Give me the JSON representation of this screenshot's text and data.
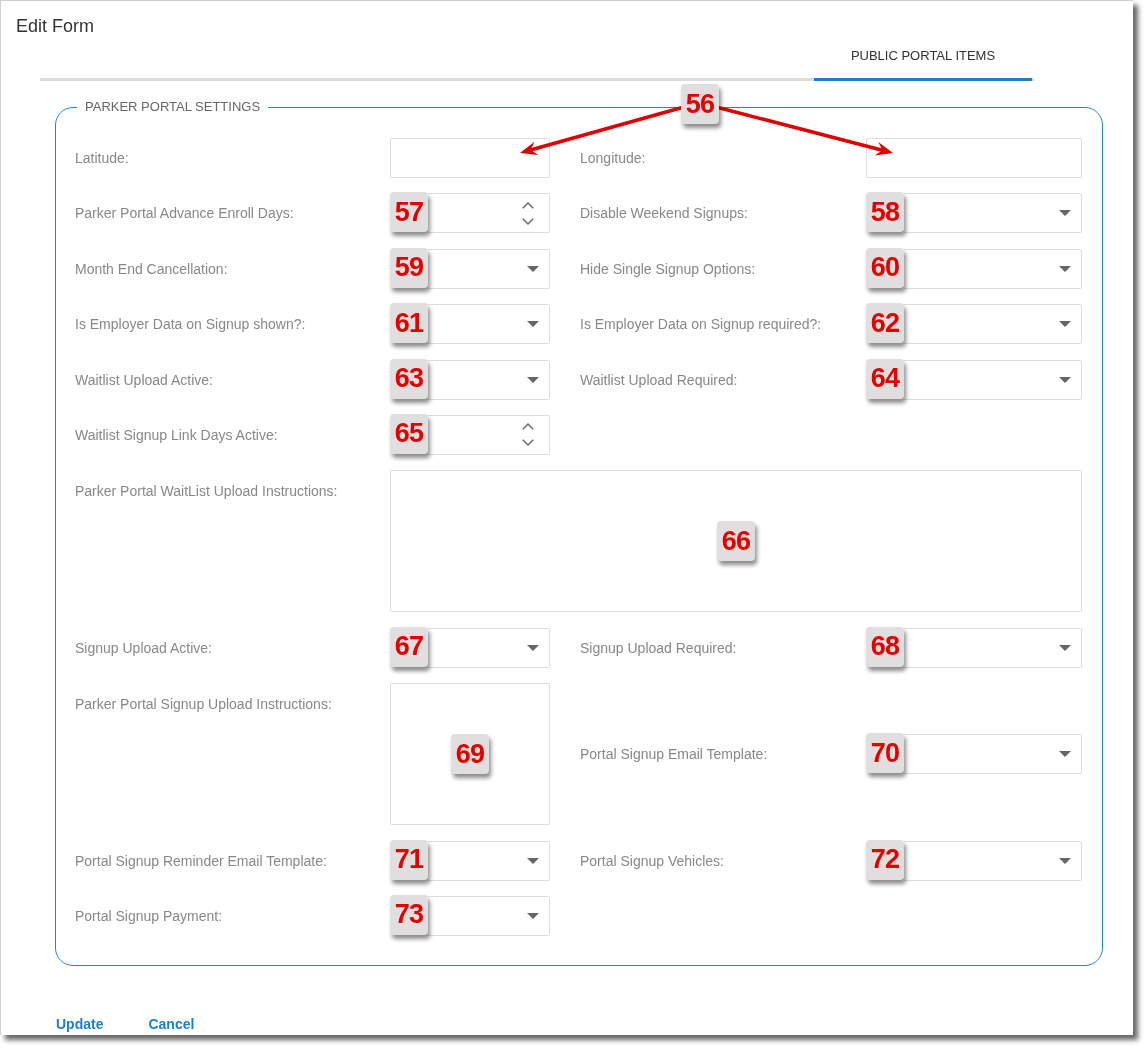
{
  "dialog": {
    "title": "Edit Form"
  },
  "tabs": [
    {
      "label": "PUBLIC PORTAL ITEMS",
      "selected": true
    }
  ],
  "fieldset": {
    "legend": "PARKER PORTAL SETTINGS",
    "rows": [
      {
        "callout": "56",
        "fields": [
          {
            "label": "Latitude:",
            "kind": "text"
          },
          {
            "label": "Longitude:",
            "kind": "text"
          }
        ]
      },
      {
        "fields": [
          {
            "label": "Parker Portal Advance Enroll Days:",
            "kind": "number",
            "callout": "57"
          },
          {
            "label": "Disable Weekend Signups:",
            "kind": "select",
            "callout": "58"
          }
        ]
      },
      {
        "fields": [
          {
            "label": "Month End Cancellation:",
            "kind": "select",
            "callout": "59"
          },
          {
            "label": "Hide Single Signup Options:",
            "kind": "select",
            "callout": "60"
          }
        ]
      },
      {
        "fields": [
          {
            "label": "Is Employer Data on Signup shown?:",
            "kind": "select",
            "callout": "61"
          },
          {
            "label": "Is Employer Data on Signup required?:",
            "kind": "select",
            "callout": "62"
          }
        ]
      },
      {
        "fields": [
          {
            "label": "Waitlist Upload Active:",
            "kind": "select",
            "callout": "63"
          },
          {
            "label": "Waitlist Upload Required:",
            "kind": "select",
            "callout": "64"
          }
        ]
      },
      {
        "fields": [
          {
            "label": "Waitlist Signup Link Days Active:",
            "kind": "number",
            "callout": "65"
          }
        ]
      },
      {
        "fields": [
          {
            "label": "Parker Portal WaitList Upload Instructions:",
            "kind": "textarea",
            "callout": "66"
          }
        ]
      },
      {
        "fields": [
          {
            "label": "Signup Upload Active:",
            "kind": "select",
            "callout": "67"
          },
          {
            "label": "Signup Upload Required:",
            "kind": "select",
            "callout": "68"
          }
        ]
      },
      {
        "fields": [
          {
            "label": "Parker Portal Signup Upload Instructions:",
            "kind": "textarea",
            "callout": "69"
          },
          {
            "label": "Portal Signup Email Template:",
            "kind": "select",
            "callout": "70"
          }
        ]
      },
      {
        "fields": [
          {
            "label": "Portal Signup Reminder Email Template:",
            "kind": "select",
            "callout": "71"
          },
          {
            "label": "Portal Signup Vehicles:",
            "kind": "select",
            "callout": "72"
          }
        ]
      },
      {
        "fields": [
          {
            "label": "Portal Signup Payment:",
            "kind": "select",
            "callout": "73"
          }
        ]
      }
    ]
  },
  "actions": [
    {
      "label": "Update"
    },
    {
      "label": "Cancel"
    }
  ]
}
